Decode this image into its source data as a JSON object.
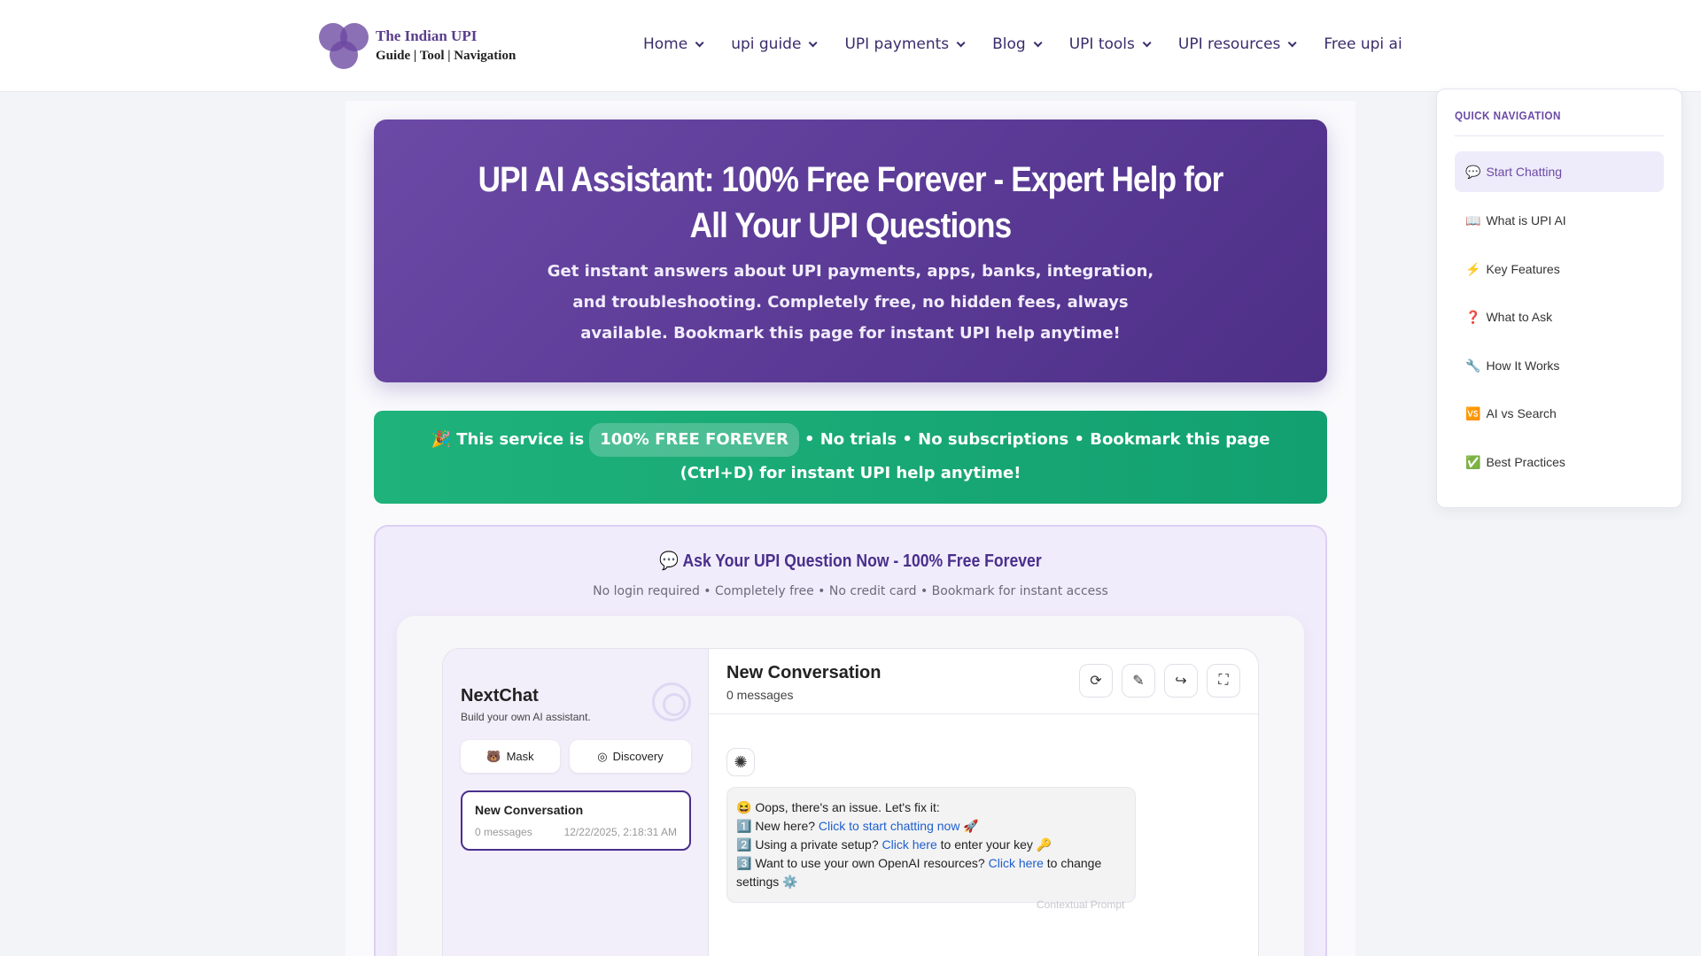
{
  "header": {
    "logo_title": "The Indian UPI",
    "logo_subtitle": "Guide | Tool | Navigation",
    "nav": [
      {
        "label": "Home",
        "dropdown": true
      },
      {
        "label": "upi guide",
        "dropdown": true
      },
      {
        "label": "UPI payments",
        "dropdown": true
      },
      {
        "label": "Blog",
        "dropdown": true
      },
      {
        "label": "UPI tools",
        "dropdown": true
      },
      {
        "label": "UPI resources",
        "dropdown": true
      },
      {
        "label": "Free upi ai",
        "dropdown": false
      }
    ]
  },
  "hero": {
    "title": "UPI AI Assistant: 100% Free Forever - Expert Help for All Your UPI Questions",
    "subtitle": "Get instant answers about UPI payments, apps, banks, integration, and troubleshooting. Completely free, no hidden fees, always available. Bookmark this page for instant UPI help anytime!"
  },
  "free_banner": {
    "prefix": "🎉 This service is",
    "pill": "100% FREE FOREVER",
    "suffix": "• No trials • No subscriptions • Bookmark this page (Ctrl+D) for instant UPI help anytime!"
  },
  "ask": {
    "title": "💬 Ask Your UPI Question Now - 100% Free Forever",
    "subtitle": "No login required • Completely free • No credit card • Bookmark for instant access"
  },
  "chat": {
    "app_name": "NextChat",
    "app_tagline": "Build your own AI assistant.",
    "mask_label": "Mask",
    "discovery_label": "Discovery",
    "conversation": {
      "title": "New Conversation",
      "messages": "0 messages",
      "timestamp": "12/22/2025, 2:18:31 AM"
    },
    "header_title": "New Conversation",
    "header_count": "0 messages",
    "message": {
      "line1": "😆 Oops, there's an issue. Let's fix it:",
      "l2_prefix": "1️⃣ New here? ",
      "l2_link": "Click to start chatting now",
      "l2_suffix": " 🚀",
      "l3_prefix": "2️⃣ Using a private setup? ",
      "l3_link": "Click here",
      "l3_suffix": " to enter your key 🔑",
      "l4_prefix": "3️⃣ Want to use your own OpenAI resources? ",
      "l4_link": "Click here",
      "l4_suffix": " to change settings ⚙️"
    },
    "context_prompt": "Contextual Prompt"
  },
  "quick_nav": {
    "title": "QUICK NAVIGATION",
    "items": [
      {
        "icon": "💬",
        "label": "Start Chatting",
        "active": true
      },
      {
        "icon": "📖",
        "label": "What is UPI AI"
      },
      {
        "icon": "⚡",
        "label": "Key Features"
      },
      {
        "icon": "❓",
        "label": "What to Ask"
      },
      {
        "icon": "🔧",
        "label": "How It Works"
      },
      {
        "icon": "🆚",
        "label": "AI vs Search"
      },
      {
        "icon": "✅",
        "label": "Best Practices"
      }
    ]
  },
  "colors": {
    "brand_purple": "#5a3d8c",
    "hero_gradient_start": "#6b4aa6",
    "banner_green": "#12a070",
    "link_blue": "#1f5fcf"
  }
}
